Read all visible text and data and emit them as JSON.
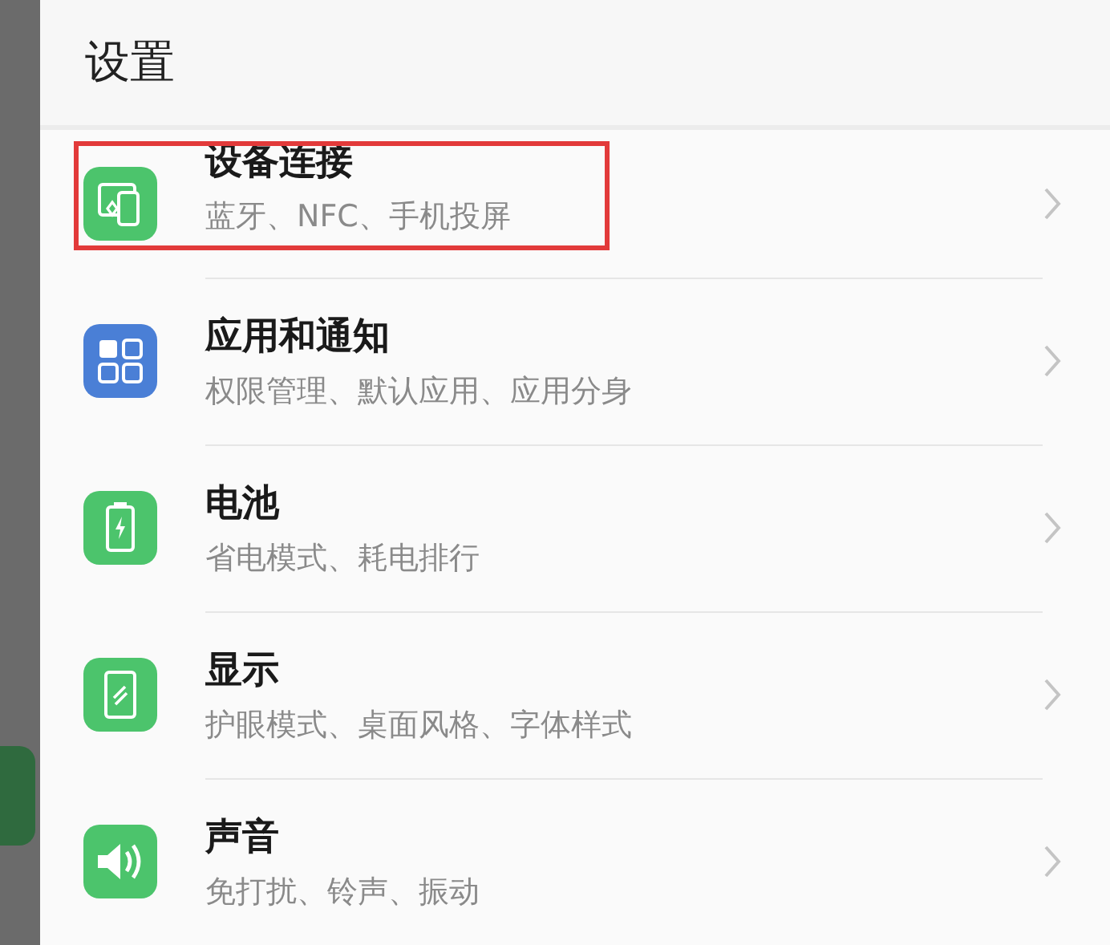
{
  "header": {
    "title": "设置"
  },
  "items": [
    {
      "title": "设备连接",
      "subtitle": "蓝牙、NFC、手机投屏",
      "color": "#4cc46c",
      "highlighted": true
    },
    {
      "title": "应用和通知",
      "subtitle": "权限管理、默认应用、应用分身",
      "color": "#4a7fd6",
      "highlighted": false
    },
    {
      "title": "电池",
      "subtitle": "省电模式、耗电排行",
      "color": "#4cc46c",
      "highlighted": false
    },
    {
      "title": "显示",
      "subtitle": "护眼模式、桌面风格、字体样式",
      "color": "#4cc46c",
      "highlighted": false
    },
    {
      "title": "声音",
      "subtitle": "免打扰、铃声、振动",
      "color": "#4cc46c",
      "highlighted": false
    }
  ]
}
